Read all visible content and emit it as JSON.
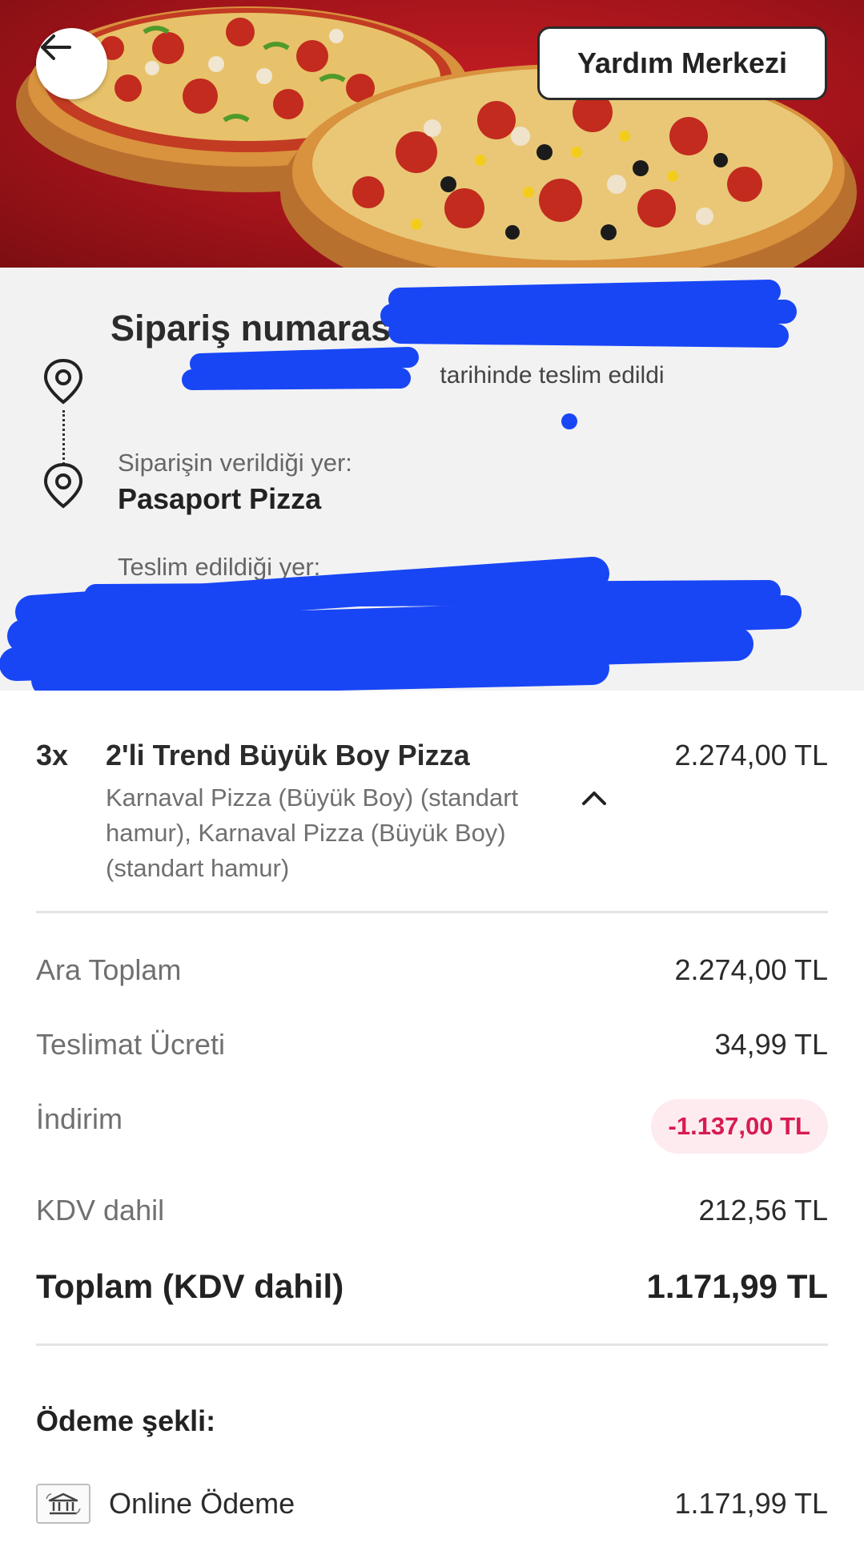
{
  "header": {
    "help_label": "Yardım Merkezi",
    "back_icon": "arrow-left-icon",
    "hero_image": "pizza-hero-image"
  },
  "order": {
    "title": "Sipariş numarası",
    "delivered_text": "tarihinde teslim edildi",
    "placed_label": "Siparişin verildiği yer:",
    "restaurant": "Pasaport Pizza",
    "delivered_label": "Teslim edildiği yer:"
  },
  "item": {
    "quantity": "3x",
    "name": "2'li Trend Büyük Boy Pizza",
    "description": "Karnaval Pizza (Büyük Boy) (standart hamur), Karnaval Pizza (Büyük Boy) (standart hamur)",
    "price": "2.274,00 TL"
  },
  "summary": {
    "subtotal_label": "Ara Toplam",
    "subtotal_value": "2.274,00 TL",
    "delivery_label": "Teslimat Ücreti",
    "delivery_value": "34,99 TL",
    "discount_label": "İndirim",
    "discount_value": "-1.137,00 TL",
    "vat_label": "KDV dahil",
    "vat_value": "212,56 TL",
    "total_label": "Toplam (KDV dahil)",
    "total_value": "1.171,99 TL"
  },
  "payment": {
    "title": "Ödeme şekli:",
    "method": "Online Ödeme",
    "amount": "1.171,99 TL",
    "icon": "bank-icon"
  },
  "colors": {
    "hero_red": "#a3141a",
    "discount_text": "#d81b52",
    "discount_bg": "#fdebef",
    "info_bg": "#f2f2f2",
    "redaction_blue": "#1846f5"
  }
}
